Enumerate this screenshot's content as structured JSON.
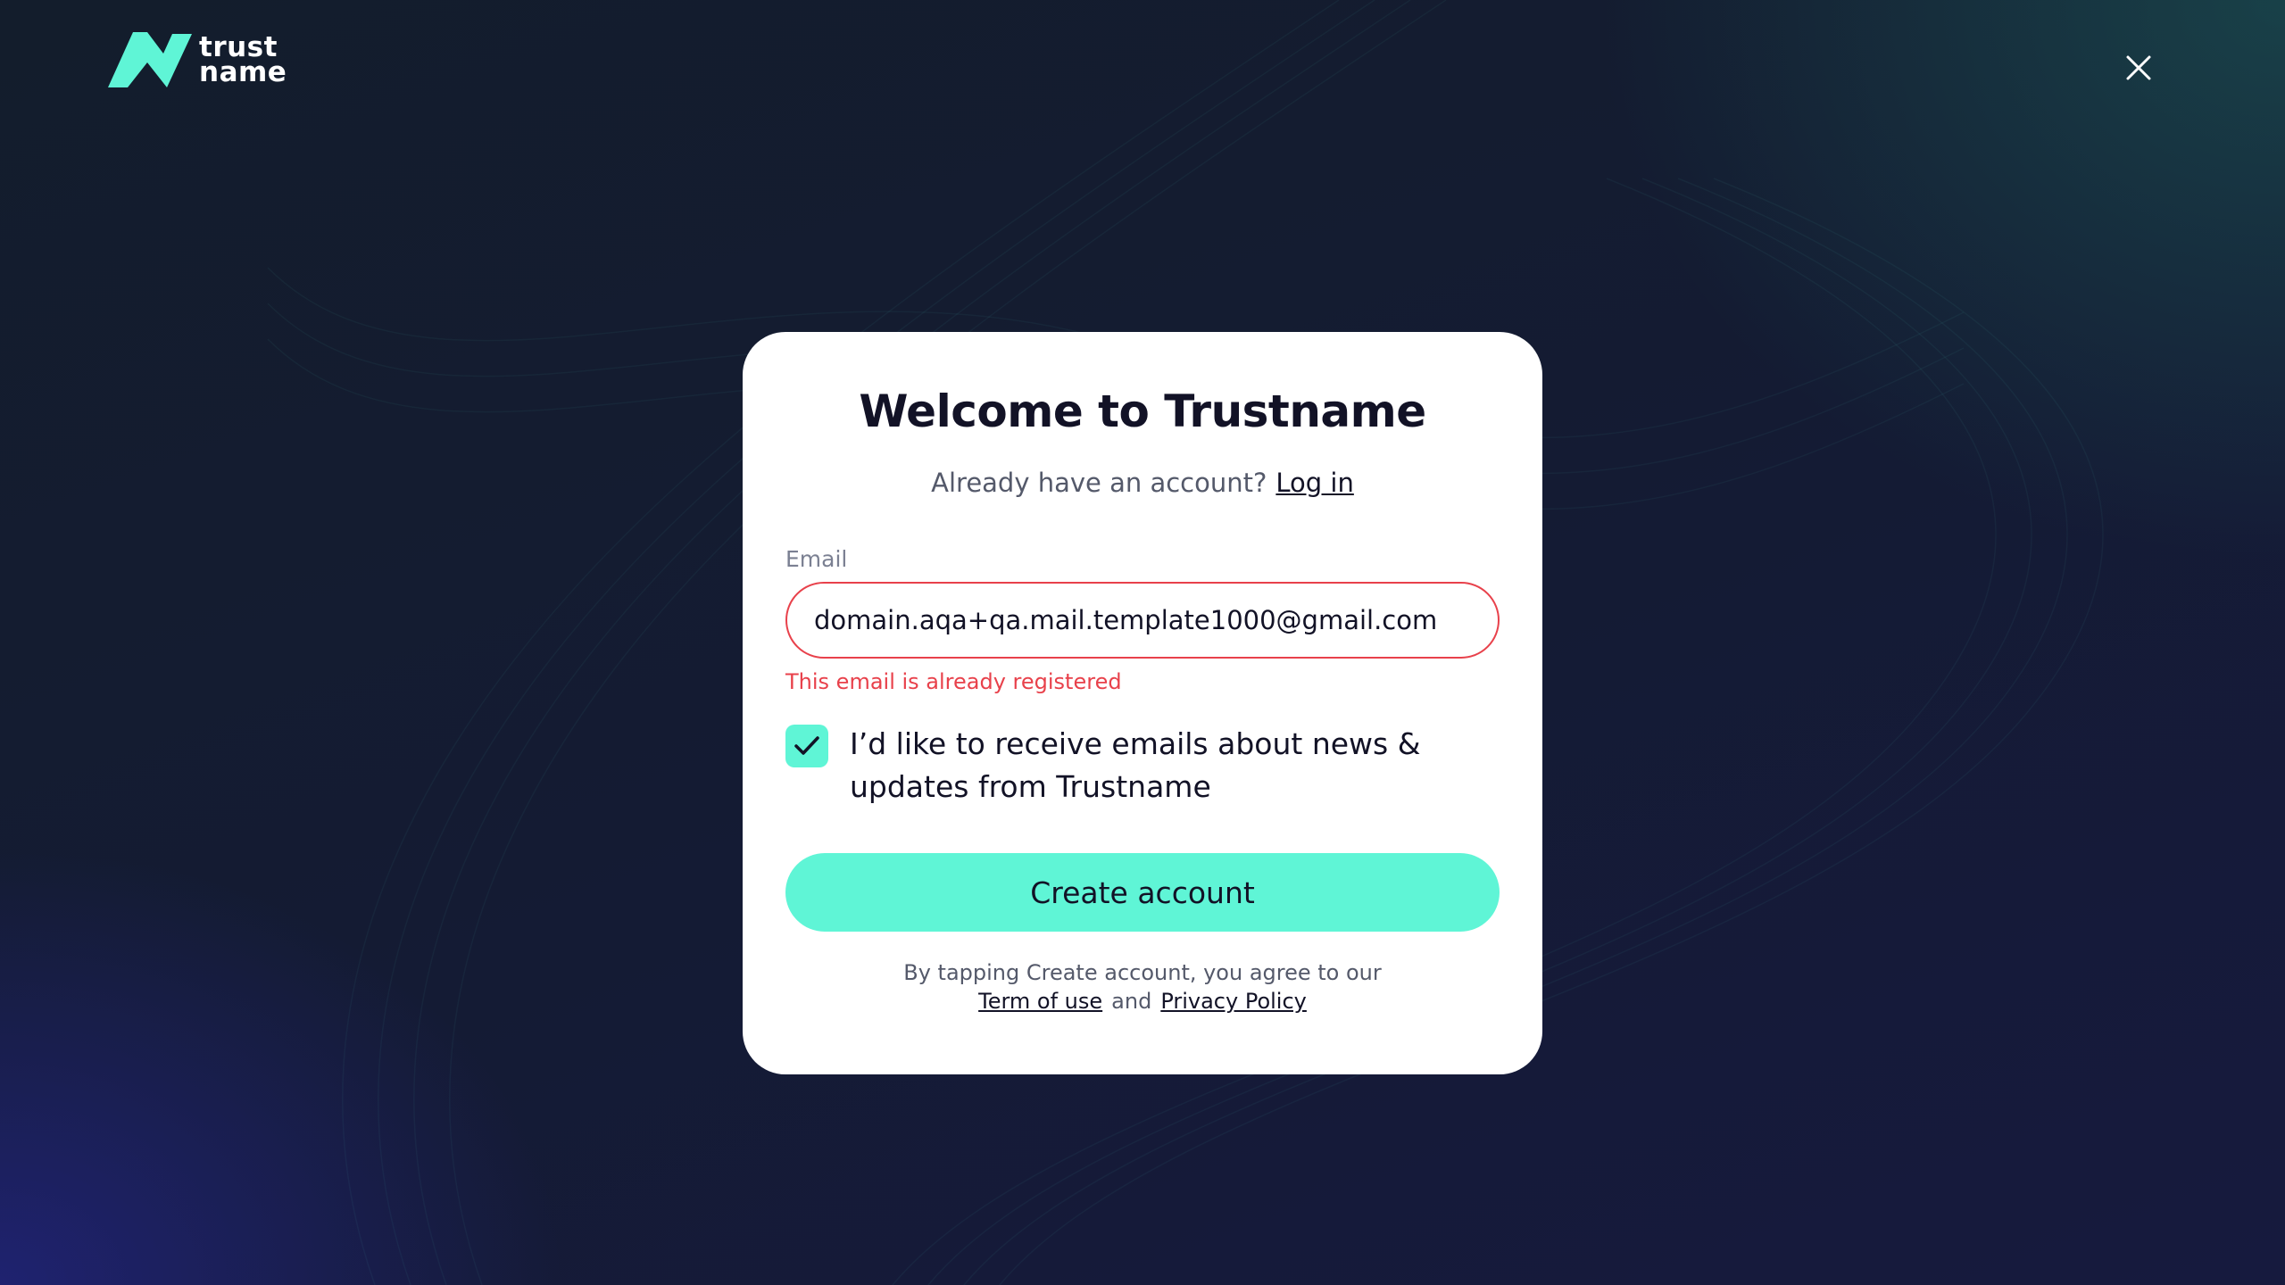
{
  "brand": {
    "line1": "trust",
    "line2": "name",
    "accent_color": "#5ff5d6"
  },
  "header": {
    "close_icon": "close-icon"
  },
  "form": {
    "title": "Welcome to Trustname",
    "subtitle_prefix": "Already have an account?",
    "login_link": "Log in",
    "email_label": "Email",
    "email_value": "domain.aqa+qa.mail.template1000@gmail.com",
    "email_error": "This email is already registered",
    "error_color": "#e8414b",
    "newsletter_checked": true,
    "newsletter_label": "I’d like to receive emails about news & updates from Trustname",
    "create_button": "Create account",
    "terms_prefix": "By tapping Create account, you agree to our",
    "terms_link": "Term of use",
    "terms_and": "and",
    "privacy_link": "Privacy Policy"
  }
}
